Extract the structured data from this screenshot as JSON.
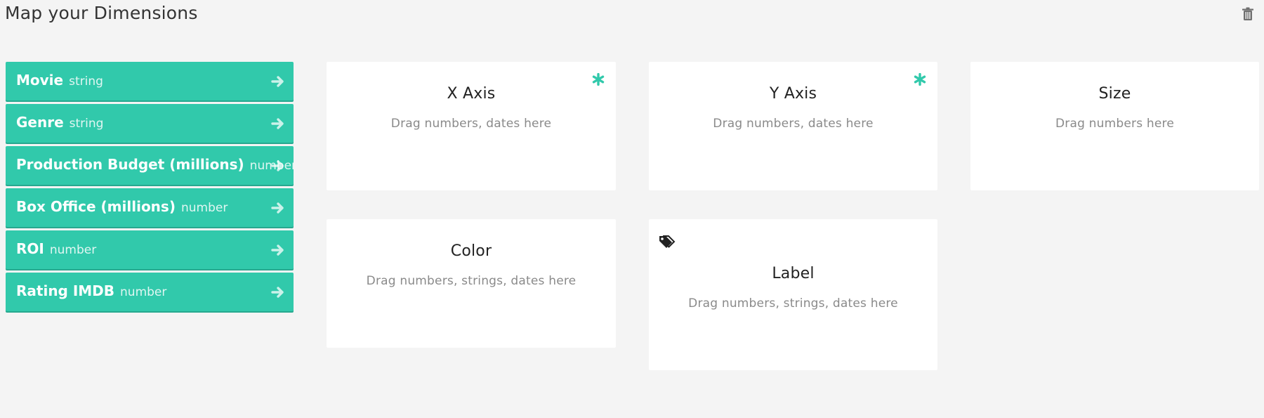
{
  "header": {
    "title": "Map your Dimensions"
  },
  "dimensions": [
    {
      "name": "Movie",
      "type": "string"
    },
    {
      "name": "Genre",
      "type": "string"
    },
    {
      "name": "Production Budget (millions)",
      "type": "number"
    },
    {
      "name": "Box Office (millions)",
      "type": "number"
    },
    {
      "name": "ROI",
      "type": "number"
    },
    {
      "name": "Rating IMDB",
      "type": "number"
    }
  ],
  "mappings": [
    {
      "title": "X Axis",
      "hint": "Drag numbers, dates here",
      "required": true
    },
    {
      "title": "Y Axis",
      "hint": "Drag numbers, dates here",
      "required": true
    },
    {
      "title": "Size",
      "hint": "Drag numbers here",
      "required": false
    },
    {
      "title": "Color",
      "hint": "Drag numbers, strings, dates here",
      "required": false
    },
    {
      "title": "Label",
      "hint": "Drag numbers, strings, dates here",
      "required": false
    }
  ],
  "icons": {
    "trash": "trash-icon",
    "arrow": "arrow-right-icon",
    "required": "asterisk-icon",
    "tags": "tags-icon"
  },
  "colors": {
    "accent": "#31c9ab",
    "background": "#f4f4f4",
    "card": "#ffffff"
  }
}
